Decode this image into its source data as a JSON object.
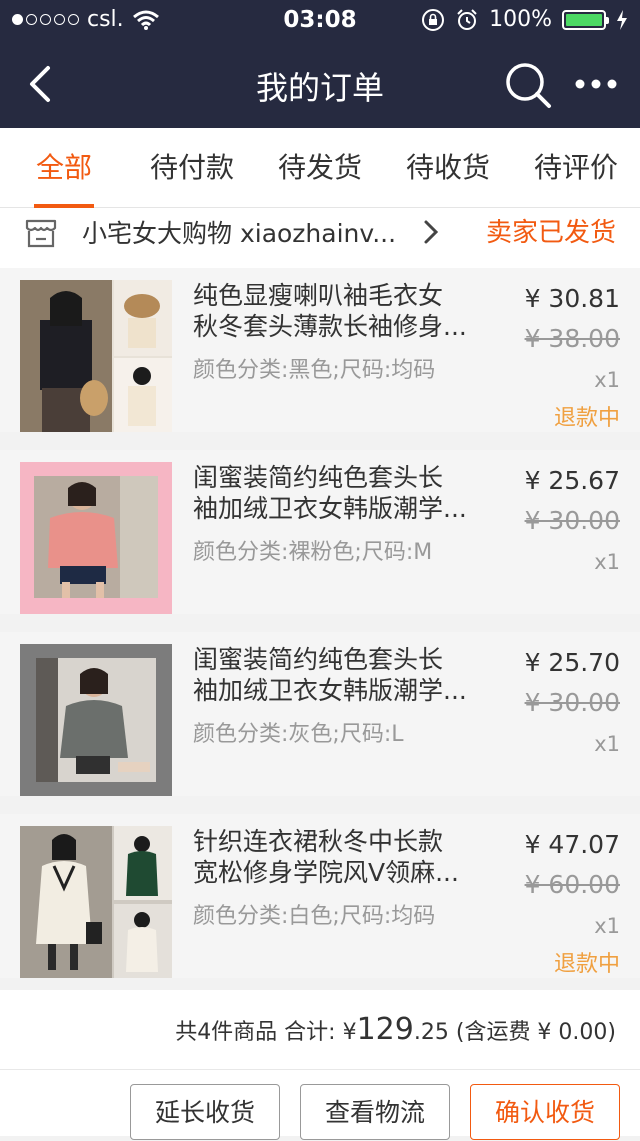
{
  "status_bar": {
    "carrier": "csl.",
    "time": "03:08",
    "battery": "100%"
  },
  "nav": {
    "title": "我的订单"
  },
  "tabs": [
    {
      "label": "全部"
    },
    {
      "label": "待付款"
    },
    {
      "label": "待发货"
    },
    {
      "label": "待收货"
    },
    {
      "label": "待评价"
    }
  ],
  "shop": {
    "name": "小宅女大购物 xiaozhainv...",
    "status": "卖家已发货"
  },
  "items": [
    {
      "title_line1": "纯色显瘦喇叭袖毛衣女",
      "title_line2": "秋冬套头薄款长袖修身...",
      "sku": "颜色分类:黑色;尺码:均码",
      "price": "¥ 30.81",
      "original_price": "¥ 38.00",
      "qty": "x1",
      "refund": "退款中"
    },
    {
      "title_line1": "闺蜜装简约纯色套头长",
      "title_line2": "袖加绒卫衣女韩版潮学...",
      "sku": "颜色分类:裸粉色;尺码:M",
      "price": "¥ 25.67",
      "original_price": "¥ 30.00",
      "qty": "x1",
      "refund": ""
    },
    {
      "title_line1": "闺蜜装简约纯色套头长",
      "title_line2": "袖加绒卫衣女韩版潮学...",
      "sku": "颜色分类:灰色;尺码:L",
      "price": "¥ 25.70",
      "original_price": "¥ 30.00",
      "qty": "x1",
      "refund": ""
    },
    {
      "title_line1": "针织连衣裙秋冬中长款",
      "title_line2": "宽松修身学院风V领麻...",
      "sku": "颜色分类:白色;尺码:均码",
      "price": "¥ 47.07",
      "original_price": "¥ 60.00",
      "qty": "x1",
      "refund": "退款中"
    }
  ],
  "summary": {
    "prefix": "共4件商品 合计:",
    "currency": "¥",
    "total_int": "129",
    "total_dec": ".25",
    "shipping": "(含运费 ¥ 0.00)"
  },
  "actions": {
    "extend": "延长收货",
    "logistics": "查看物流",
    "confirm": "确认收货"
  },
  "colors": {
    "accent": "#f25a11",
    "navbar": "#262a40",
    "refund": "#f0a040"
  }
}
